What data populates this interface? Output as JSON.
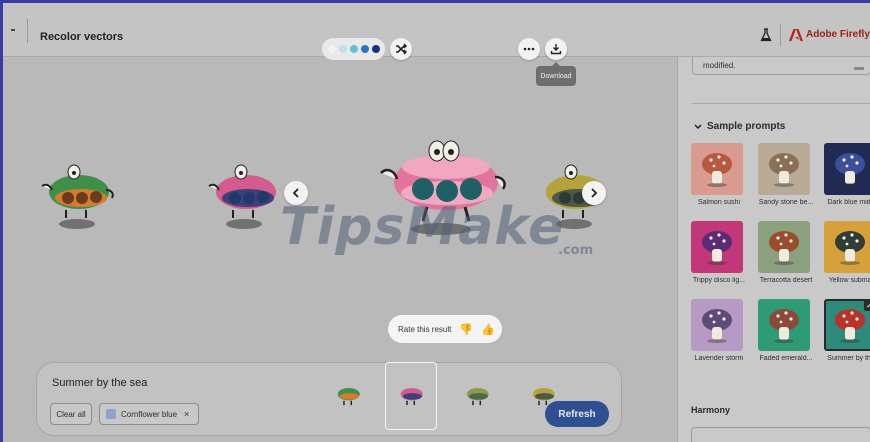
{
  "header": {
    "title": "Recolor vectors",
    "palette_swatches": [
      "#eef3f6",
      "#bfe0ea",
      "#5ec1d6",
      "#2d74c8",
      "#1c2f85"
    ],
    "shuffle_icon": "shuffle-icon",
    "more_icon": "ellipsis-icon",
    "download_icon": "download-icon",
    "download_tooltip": "Download",
    "labs_icon": "beaker-icon",
    "brand_label": "Adobe Firefly ("
  },
  "canvas": {
    "watermark_main": "TipsMake",
    "watermark_suffix": ".com",
    "rating_prompt": "Rate this result",
    "thumbs_down_icon": "thumbs-down-icon",
    "thumbs_up_icon": "thumbs-up-icon",
    "prev_icon": "chevron-left-icon",
    "next_icon": "chevron-right-icon"
  },
  "prompt_panel": {
    "prompt_text": "Summer by the sea",
    "clear_label": "Clear all",
    "tag_label": "Cornflower blue",
    "tag_remove": "×",
    "refresh_label": "Refresh",
    "selected_index": 1
  },
  "sidebar": {
    "modified_text": "modified.",
    "sample_section_label": "Sample prompts",
    "samples": [
      {
        "label": "Salmon sushi",
        "bg": "#d99a90",
        "cap": "#b9573f"
      },
      {
        "label": "Sandy stone be...",
        "bg": "#b8aa97",
        "cap": "#8a6f57"
      },
      {
        "label": "Dark blue mid...",
        "bg": "#1f2a55",
        "cap": "#3c4e9c"
      },
      {
        "label": "Trippy disco lig...",
        "bg": "#c2367a",
        "cap": "#5b2b78"
      },
      {
        "label": "Terracotta desert",
        "bg": "#8aa07e",
        "cap": "#9a4c2e"
      },
      {
        "label": "Yellow submari",
        "bg": "#d6a13a",
        "cap": "#2f3d36"
      },
      {
        "label": "Lavender storm",
        "bg": "#b699c4",
        "cap": "#5d4c7b"
      },
      {
        "label": "Faded emerald...",
        "bg": "#2f9b74",
        "cap": "#8c4a3a"
      },
      {
        "label": "Summer by th...",
        "bg": "#2e8a7a",
        "cap": "#b8332c"
      }
    ],
    "checked_sample": 8,
    "harmony_label": "Harmony"
  }
}
